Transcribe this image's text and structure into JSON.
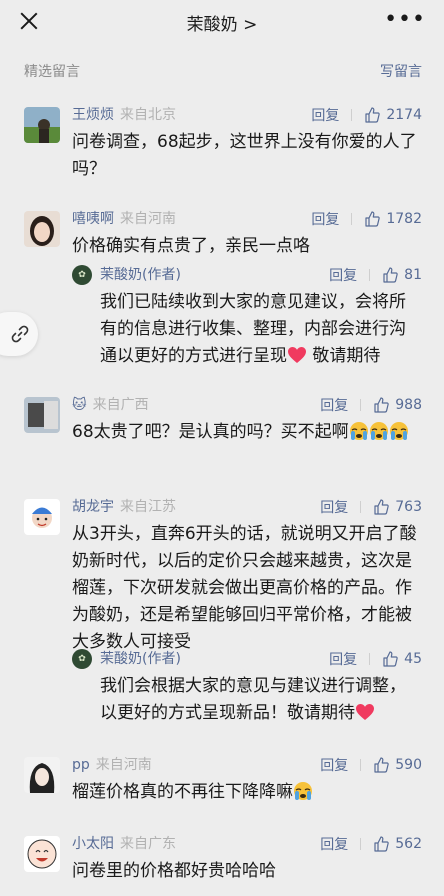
{
  "topbar": {
    "title": "茉酸奶 >",
    "more": "•••"
  },
  "section": {
    "label": "精选留言",
    "write": "写留言"
  },
  "comments": [
    {
      "nick": "王烦烦",
      "loc": "来自北京",
      "reply": "回复",
      "likes": "2174",
      "text": "问卷调查，68起步，这世界上没有你爱的人了吗？"
    },
    {
      "nick": "嘻咦啊",
      "loc": "来自河南",
      "reply": "回复",
      "likes": "1782",
      "text": "价格确实有点贵了，亲民一点咯",
      "author_reply": {
        "name": "茉酸奶(作者)",
        "reply": "回复",
        "likes": "81",
        "text": "我们已陆续收到大家的意见建议，会将所有的信息进行收集、整理，内部会进行沟通以更好的方式进行呈现",
        "text_tail": " 敬请期待"
      }
    },
    {
      "nick": "🐱",
      "loc": "来自广西",
      "reply": "回复",
      "likes": "988",
      "text": "68太贵了吧？是认真的吗？买不起啊"
    },
    {
      "nick": "胡龙宇",
      "loc": "来自江苏",
      "reply": "回复",
      "likes": "763",
      "text": "从3开头，直奔6开头的话，就说明又开启了酸奶新时代，以后的定价只会越来越贵，这次是榴莲，下次研发就会做出更高价格的产品。作为酸奶，还是希望能够回归平常价格，才能被大多数人可接受",
      "author_reply": {
        "name": "茉酸奶(作者)",
        "reply": "回复",
        "likes": "45",
        "text": "我们会根据大家的意见与建议进行调整，以更好的方式呈现新品！敬请期待"
      }
    },
    {
      "nick": "pp",
      "loc": "来自河南",
      "reply": "回复",
      "likes": "590",
      "text": "榴莲价格真的不再往下降降嘛"
    },
    {
      "nick": "小太阳",
      "loc": "来自广东",
      "reply": "回复",
      "likes": "562",
      "text": "问卷里的价格都好贵哈哈哈"
    }
  ],
  "colors": {
    "link": "#576b95",
    "bg": "#ededed",
    "text": "#1a1a1a",
    "muted": "#b2b2b2"
  }
}
